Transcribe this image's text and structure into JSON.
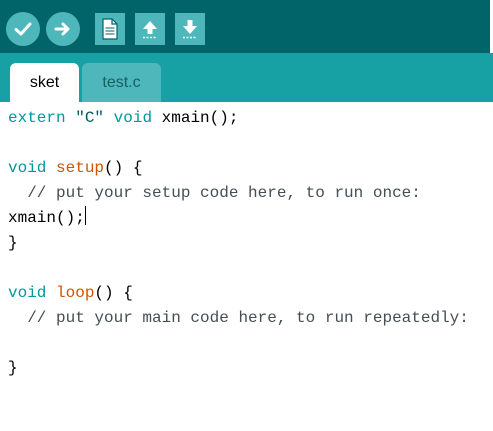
{
  "toolbar": {
    "buttons": [
      {
        "id": "verify",
        "icon": "checkmark-icon"
      },
      {
        "id": "upload",
        "icon": "arrow-right-icon"
      },
      {
        "id": "new",
        "icon": "new-file-icon"
      },
      {
        "id": "open",
        "icon": "arrow-up-icon"
      },
      {
        "id": "save",
        "icon": "arrow-down-icon"
      }
    ]
  },
  "tabs": [
    {
      "label": "sket",
      "active": true
    },
    {
      "label": "test.c",
      "active": false
    }
  ],
  "editor": {
    "lines": {
      "l1": {
        "kw1": "extern",
        "sp1": " ",
        "str": "\"C\"",
        "sp2": " ",
        "kw2": "void",
        "rest": " xmain();"
      },
      "l3": {
        "kw": "void",
        "sp": " ",
        "fn": "setup",
        "rest": "() {"
      },
      "l4": {
        "comment": "  // put your setup code here, to run once:"
      },
      "l5": {
        "text": "xmain();"
      },
      "l6": {
        "text": "}"
      },
      "l8": {
        "kw": "void",
        "sp": " ",
        "fn": "loop",
        "rest": "() {"
      },
      "l9": {
        "comment": "  // put your main code here, to run repeatedly:"
      },
      "l11": {
        "text": "}"
      }
    }
  },
  "colors": {
    "toolbar_bg": "#006468",
    "tabbar_bg": "#17a1a5",
    "button_bg": "#4db7bb",
    "keyword": "#00979c",
    "function": "#d35400"
  }
}
